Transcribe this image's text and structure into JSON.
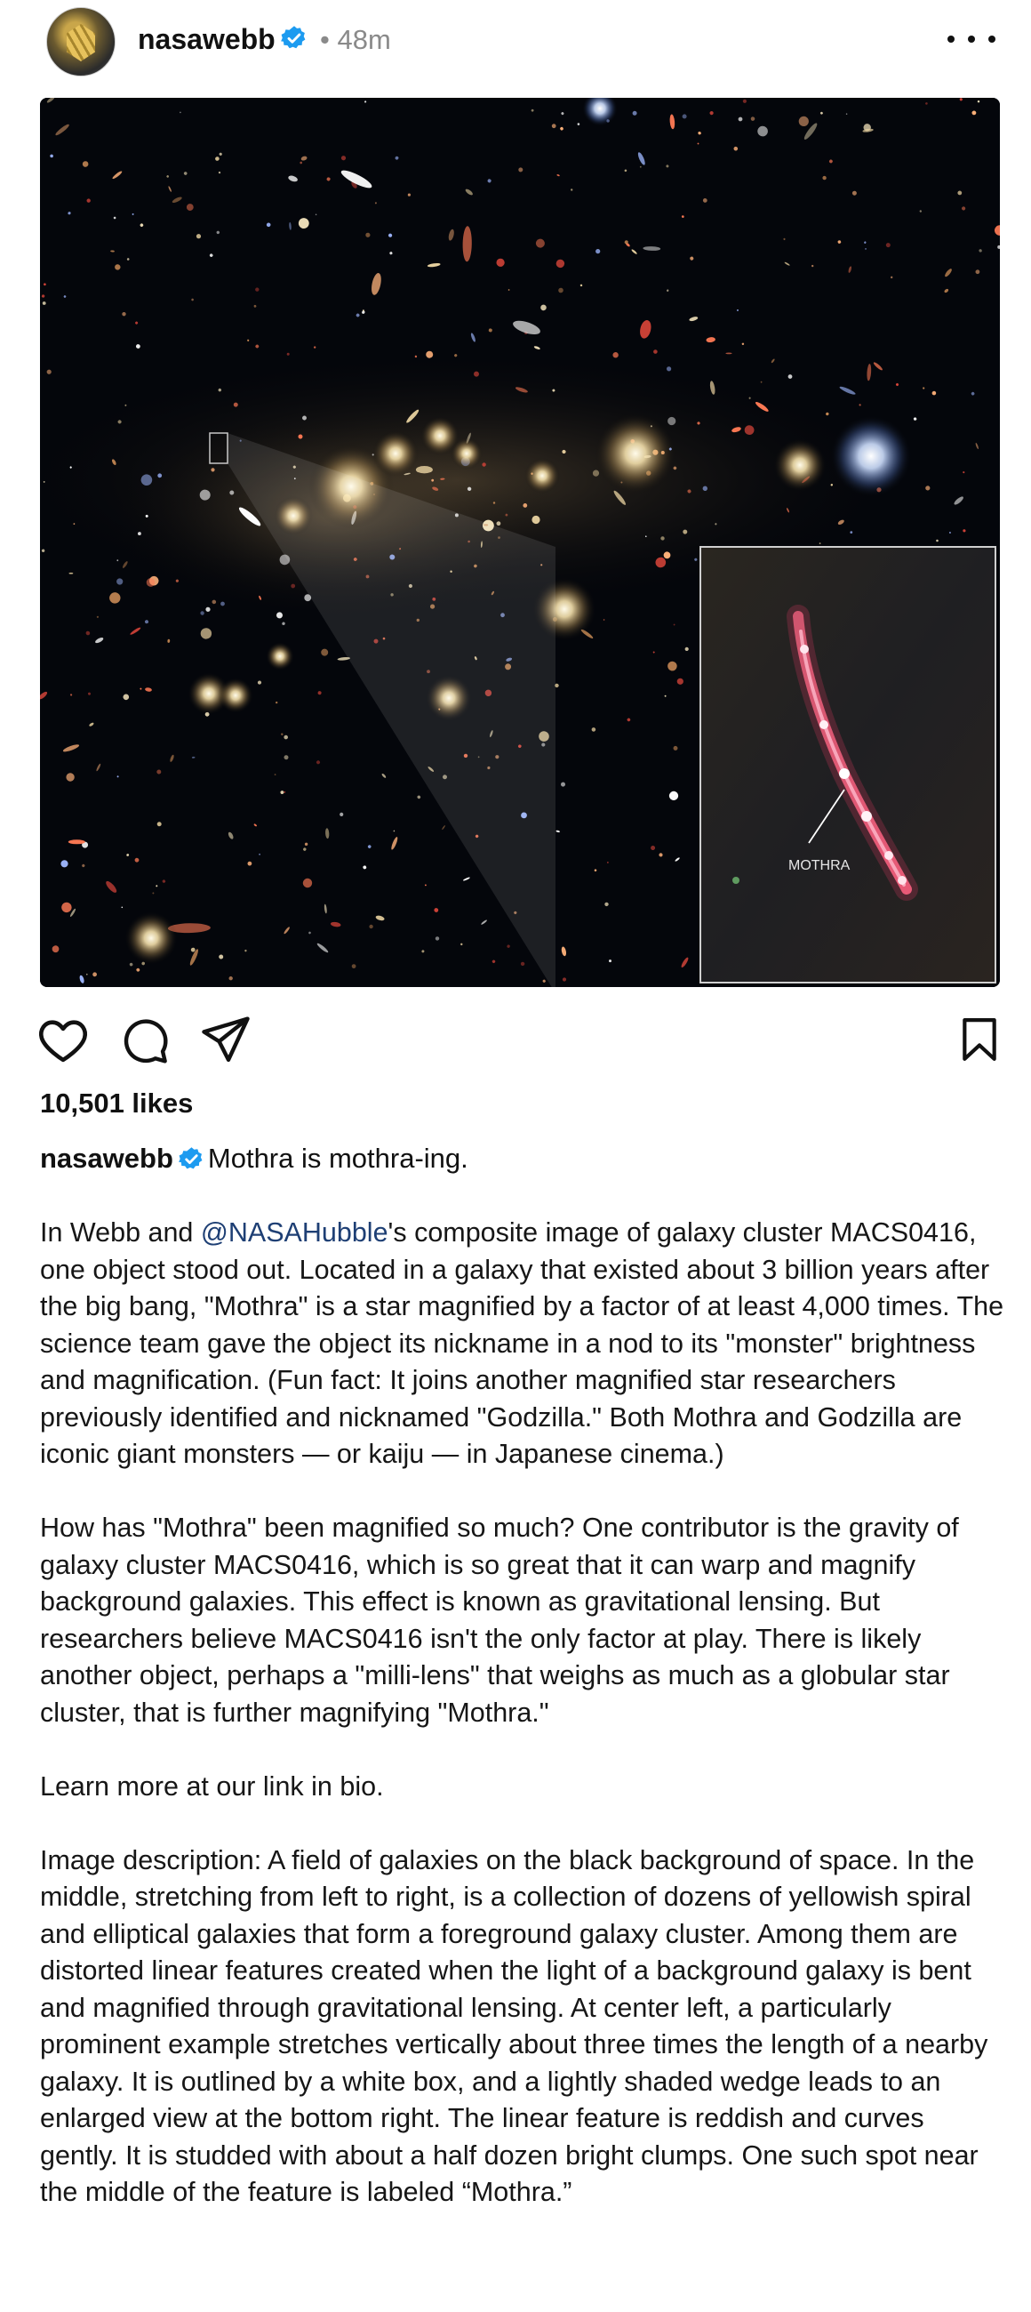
{
  "post": {
    "username": "nasawebb",
    "separator": "•",
    "timestamp": "48m",
    "image": {
      "inset_label": "MOTHRA"
    },
    "likes_text": "10,501 likes",
    "caption": {
      "headline": "Mothra is mothra-ing.",
      "p1_before": "In Webb and ",
      "p1_mention": "@NASAHubble",
      "p1_after": "'s composite image of galaxy cluster MACS0416, one object stood out. Located in a galaxy that existed about 3 billion years after the big bang, \"Mothra\" is a star magnified by a factor of at least 4,000 times. The science team gave the object its nickname in a nod to its \"monster\" brightness and magnification. (Fun fact: It joins another magnified star researchers previously identified and nicknamed \"Godzilla.\" Both Mothra and Godzilla are iconic giant monsters — or kaiju — in Japanese cinema.)",
      "p2": "How has \"Mothra\" been magnified so much? One contributor is the gravity of galaxy cluster MACS0416, which is so great that it can warp and magnify background galaxies. This effect is known as gravitational lensing. But researchers believe MACS0416 isn't the only factor at play. There is likely another object, perhaps a \"milli-lens\" that weighs as much as a globular star cluster, that is further magnifying \"Mothra.\"",
      "p3": "Learn more at our link in bio.",
      "p4": "Image description: A field of galaxies on the black background of space. In the middle, stretching from left to right, is a collection of dozens of yellowish spiral and elliptical galaxies that form a foreground galaxy cluster. Among them are distorted linear features created when the light of a background galaxy is bent and magnified through gravitational lensing. At center left, a particularly prominent example stretches vertically about three times the length of a nearby galaxy. It is outlined by a white box, and a lightly shaded wedge leads to an enlarged view at the bottom right. The linear feature is reddish and curves gently. It is studded with about a half dozen bright clumps. One such spot near the middle of the feature is labeled “Mothra.”"
    }
  },
  "icons": {
    "avatar": "webb-mirror-avatar",
    "verified": "verified-badge-icon",
    "more": "more-options-icon",
    "like": "heart-icon",
    "comment": "comment-bubble-icon",
    "share": "paper-plane-icon",
    "save": "bookmark-icon"
  },
  "colors": {
    "verified": "#1d9bf0",
    "mention": "#1e3f74",
    "timestamp": "#8a8a8a"
  }
}
